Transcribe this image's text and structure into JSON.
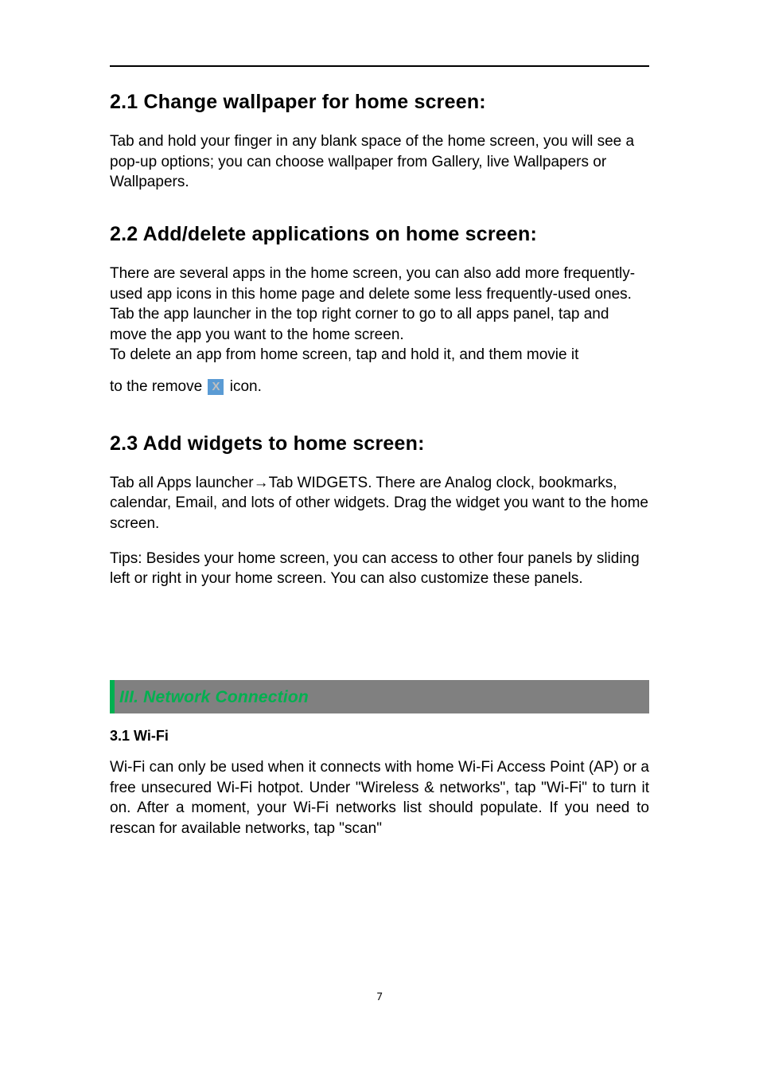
{
  "sections": {
    "s21": {
      "heading": "2.1 Change wallpaper for home screen:",
      "body": "Tab and hold your finger in any blank space of the home screen, you will see a pop-up options; you can choose wallpaper from Gallery, live Wallpapers or Wallpapers."
    },
    "s22": {
      "heading": "2.2 Add/delete applications on home screen:",
      "p1": "There are several apps in the home screen, you can also add more frequently-used app icons in this home page and delete some less frequently-used ones.",
      "p2": "Tab the app launcher in the top right corner to go to all apps panel, tap and move the app you want to the home screen.",
      "p3": "To delete an app from home screen, tap and hold it, and them movie it",
      "remove_prefix": "to the remove",
      "remove_icon_glyph": "X",
      "remove_suffix": " icon."
    },
    "s23": {
      "heading": "2.3 Add widgets to home screen:",
      "p1": "Tab all Apps launcher→Tab WIDGETS. There are Analog clock, bookmarks, calendar, Email, and lots of other widgets. Drag the widget you want to the home screen.",
      "p2": "Tips: Besides your home screen, you can access to other four panels by sliding left or right in your home screen. You can also customize these panels."
    },
    "chapter3": {
      "title": "III. Network Connection",
      "s31": {
        "heading": "3.1 Wi-Fi",
        "body": "Wi-Fi can only be used when it connects with home Wi-Fi Access Point (AP) or a free unsecured Wi-Fi hotpot. Under \"Wireless & networks\", tap \"Wi-Fi\" to turn it on. After a moment, your Wi-Fi networks list should populate. If you need to rescan for available networks, tap \"scan\""
      }
    }
  },
  "page_number": "7"
}
